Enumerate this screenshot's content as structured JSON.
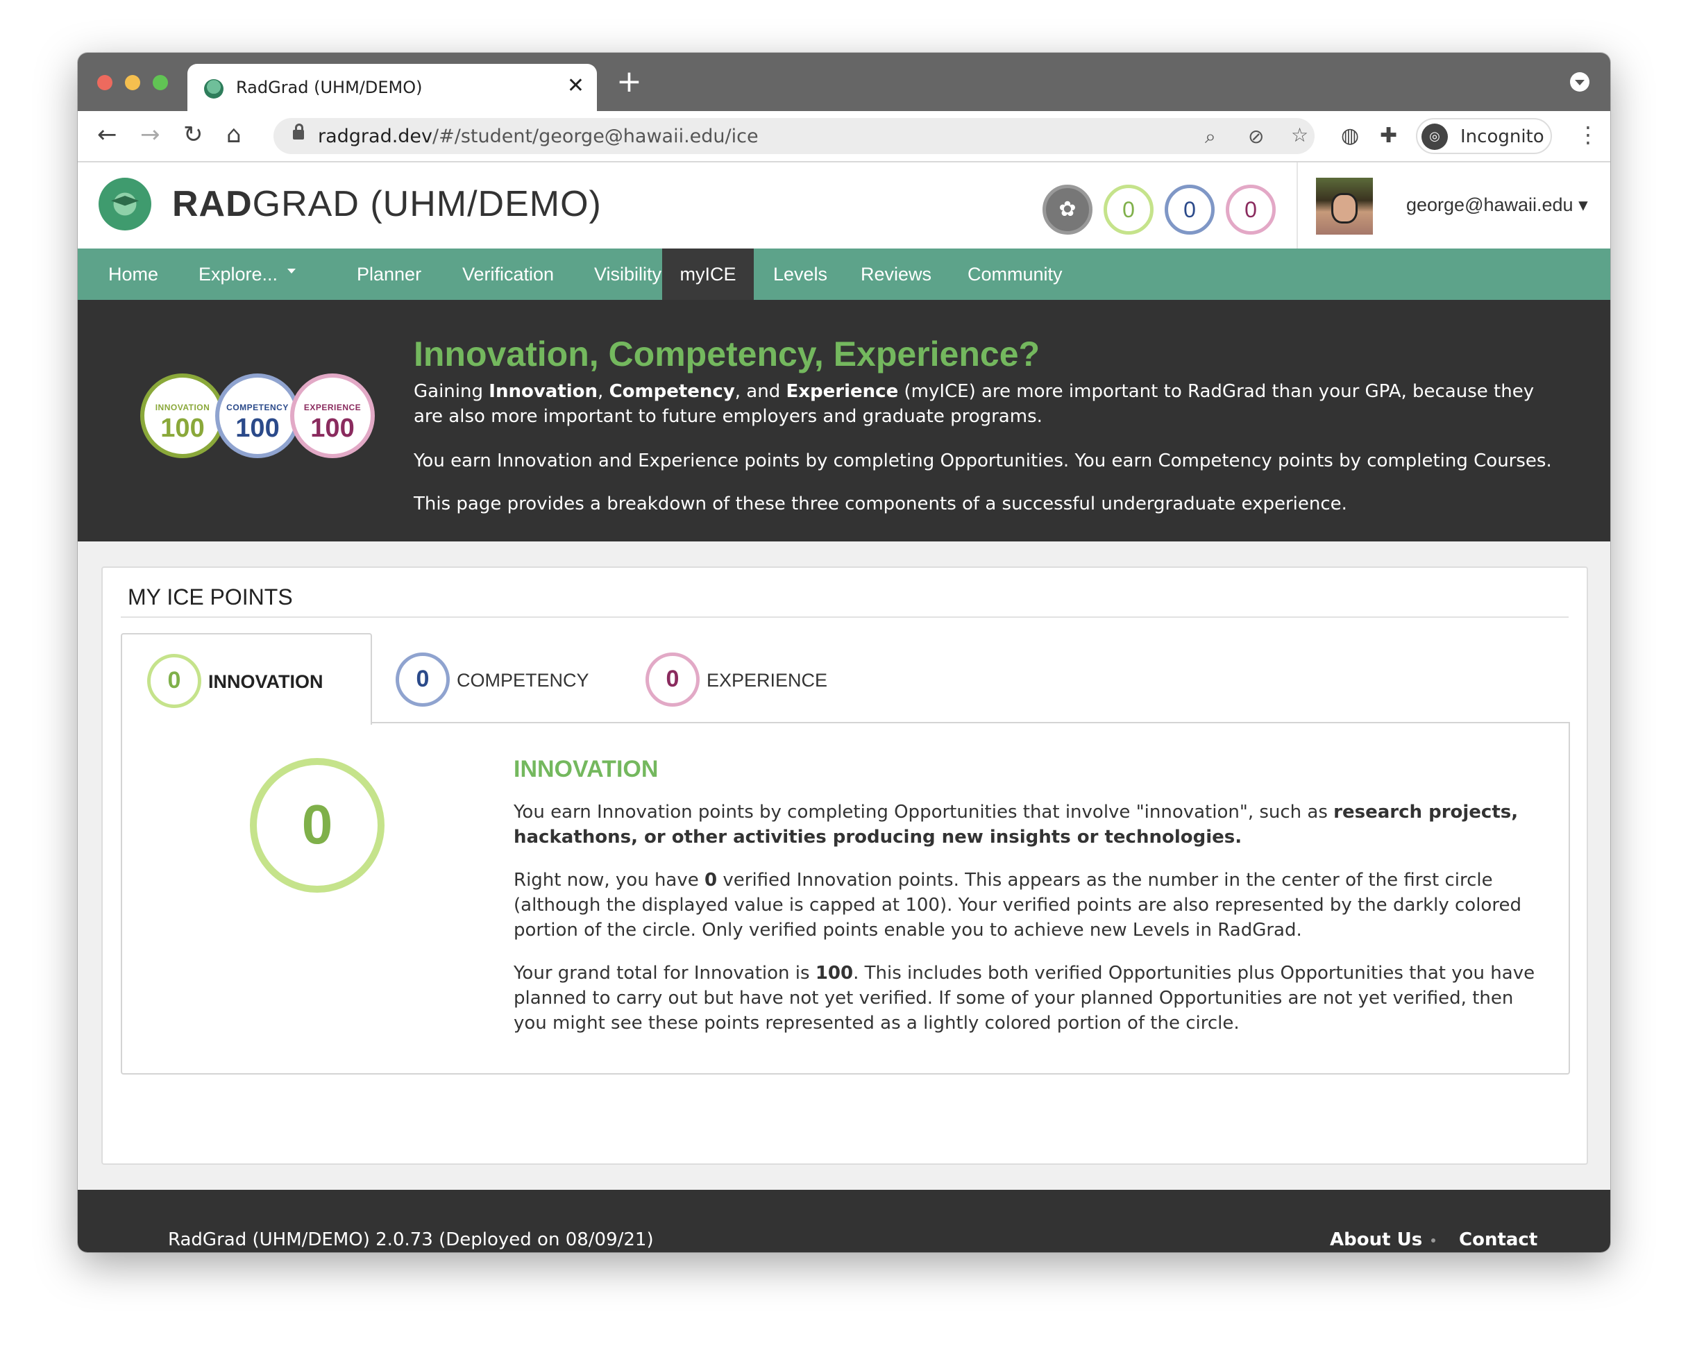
{
  "browser": {
    "tab_title": "RadGrad (UHM/DEMO)",
    "tab_close": "✕",
    "new_tab": "+",
    "url_host": "radgrad.dev",
    "url_path": "/#/student/george@hawaii.edu/ice",
    "incognito_label": "Incognito"
  },
  "header": {
    "title_bold": "RAD",
    "title_rest": "GRAD (UHM/DEMO)",
    "ice_innovation": "0",
    "ice_competency": "0",
    "ice_experience": "0",
    "user_label": "george@hawaii.edu ▾"
  },
  "nav": {
    "items": [
      "Home",
      "Explore...",
      "Planner",
      "Verification",
      "Visibility",
      "myICE",
      "Levels",
      "Reviews",
      "Community"
    ],
    "active": "myICE"
  },
  "hero": {
    "badges": [
      {
        "label": "INNOVATION",
        "value": "100"
      },
      {
        "label": "COMPETENCY",
        "value": "100"
      },
      {
        "label": "EXPERIENCE",
        "value": "100"
      }
    ],
    "title": "Innovation, Competency, Experience?",
    "p1_a": "Gaining ",
    "p1_b": "Innovation",
    "p1_c": ", ",
    "p1_d": "Competency",
    "p1_e": ", and ",
    "p1_f": "Experience",
    "p1_g": " (myICE) are more important to RadGrad than your GPA, because they are also more important to future employers and graduate programs.",
    "p2": "You earn Innovation and Experience points by completing Opportunities. You earn Competency points by completing Courses.",
    "p3": "This page provides a breakdown of these three components of a successful undergraduate experience."
  },
  "panel": {
    "title": "MY ICE POINTS",
    "tabs": [
      {
        "value": "0",
        "label": "INNOVATION"
      },
      {
        "value": "0",
        "label": "COMPETENCY"
      },
      {
        "value": "0",
        "label": "EXPERIENCE"
      }
    ],
    "active_tab": "INNOVATION",
    "big_value": "0",
    "section_title": "INNOVATION",
    "s1_a": "You earn Innovation points by completing Opportunities that involve \"innovation\", such as ",
    "s1_b": "research projects, hackathons, or other activities producing new insights or technologies.",
    "s2_a": "Right now, you have ",
    "s2_b": "0",
    "s2_c": " verified Innovation points. This appears as the number in the center of the first circle (although the displayed value is capped at 100). Your verified points are also represented by the darkly colored portion of the circle. Only verified points enable you to achieve new Levels in RadGrad.",
    "s3_a": "Your grand total for Innovation is ",
    "s3_b": "100",
    "s3_c": ". This includes both verified Opportunities plus Opportunities that you have planned to carry out but have not yet verified. If some of your planned Opportunities are not yet verified, then you might see these points represented as a lightly colored portion of the circle."
  },
  "footer": {
    "version": "RadGrad (UHM/DEMO) 2.0.73 (Deployed on 08/09/21)",
    "about": "About Us",
    "contact": "Contact"
  },
  "colors": {
    "brand_green": "#5da38a",
    "innovation": "#7fb04a",
    "competency": "#2b4a8a",
    "experience": "#8a2b5e",
    "dark": "#333333"
  }
}
